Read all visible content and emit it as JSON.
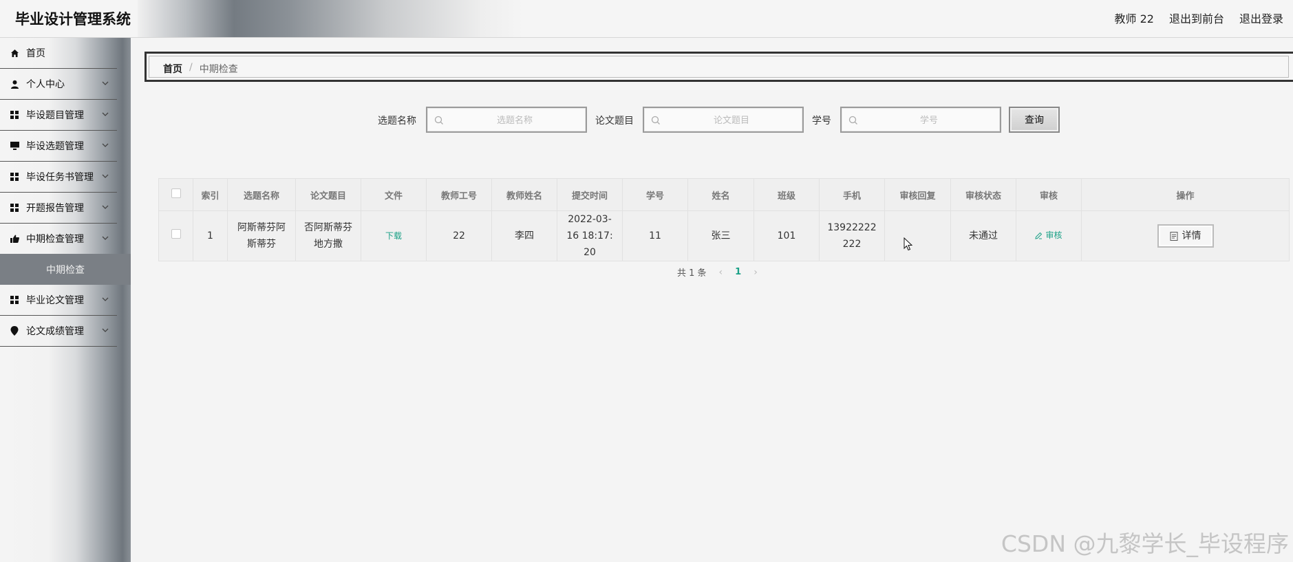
{
  "header": {
    "title": "毕业设计管理系统",
    "user": "教师 22",
    "front_link": "退出到前台",
    "logout_link": "退出登录"
  },
  "sidebar": {
    "items": [
      {
        "label": "首页",
        "icon": "home-icon"
      },
      {
        "label": "个人中心",
        "icon": "person-icon"
      },
      {
        "label": "毕设题目管理",
        "icon": "grid-icon"
      },
      {
        "label": "毕设选题管理",
        "icon": "monitor-icon"
      },
      {
        "label": "毕设任务书管理",
        "icon": "grid-icon"
      },
      {
        "label": "开题报告管理",
        "icon": "grid-icon"
      },
      {
        "label": "中期检查管理",
        "icon": "thumb-icon"
      },
      {
        "label": "毕业论文管理",
        "icon": "grid-icon"
      },
      {
        "label": "论文成绩管理",
        "icon": "pin-icon"
      }
    ],
    "active_sub": "中期检查"
  },
  "breadcrumb": {
    "home": "首页",
    "separator": "/",
    "current": "中期检查"
  },
  "search": {
    "topic_label": "选题名称",
    "topic_placeholder": "选题名称",
    "paper_label": "论文题目",
    "paper_placeholder": "论文题目",
    "student_label": "学号",
    "student_placeholder": "学号",
    "query_button": "查询"
  },
  "table": {
    "headers": [
      "索引",
      "选题名称",
      "论文题目",
      "文件",
      "教师工号",
      "教师姓名",
      "提交时间",
      "学号",
      "姓名",
      "班级",
      "手机",
      "审核回复",
      "审核状态",
      "审核",
      "操作"
    ],
    "rows": [
      {
        "index": "1",
        "topic": "阿斯蒂芬阿斯蒂芬",
        "paper": "否阿斯蒂芬地方撒",
        "file": "下载",
        "teacher_id": "22",
        "teacher_name": "李四",
        "submit_time": "2022-03-16 18:17:20",
        "student_id": "11",
        "student_name": "张三",
        "class": "101",
        "phone": "13922222222",
        "reply": "",
        "status": "未通过",
        "audit": "审核",
        "detail": "详情"
      }
    ]
  },
  "pagination": {
    "total": "共 1 条",
    "current_page": "1"
  },
  "watermark": "CSDN @九黎学长_毕设程序",
  "colors": {
    "accent": "#1aa086",
    "sidebar_sub_bg": "#7a7f85"
  }
}
